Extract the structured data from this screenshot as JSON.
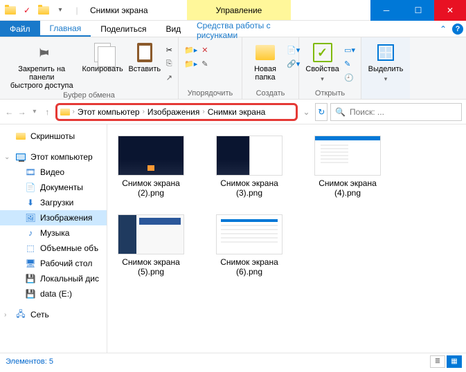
{
  "title": "Снимки экрана",
  "tooltab": "Управление",
  "tabs": {
    "file": "Файл",
    "home": "Главная",
    "share": "Поделиться",
    "view": "Вид",
    "tool": "Средства работы с рисунками"
  },
  "ribbon": {
    "pin": "Закрепить на панели\nбыстрого доступа",
    "copy": "Копировать",
    "paste": "Вставить",
    "clipboard_group": "Буфер обмена",
    "organize_group": "Упорядочить",
    "newfolder": "Новая\nпапка",
    "create_group": "Создать",
    "properties": "Свойства",
    "open_group": "Открыть",
    "select": "Выделить",
    "select_dd": "▾"
  },
  "breadcrumbs": [
    "Этот компьютер",
    "Изображения",
    "Снимки экрана"
  ],
  "search_placeholder": "Поиск: ...",
  "nav": {
    "screenshots": "Скриншоты",
    "thispc": "Этот компьютер",
    "video": "Видео",
    "documents": "Документы",
    "downloads": "Загрузки",
    "pictures": "Изображения",
    "music": "Музыка",
    "volumes": "Объемные объ",
    "desktop": "Рабочий стол",
    "localdisk": "Локальный дис",
    "datae": "data (E:)",
    "network": "Сеть"
  },
  "files": [
    {
      "name": "Снимок экрана (2).png",
      "thumb": "dark"
    },
    {
      "name": "Снимок экрана (3).png",
      "thumb": "split"
    },
    {
      "name": "Снимок экрана (4).png",
      "thumb": "app1"
    },
    {
      "name": "Снимок экрана (5).png",
      "thumb": "dash"
    },
    {
      "name": "Снимок экрана (6).png",
      "thumb": "doc"
    }
  ],
  "status": "Элементов: 5"
}
